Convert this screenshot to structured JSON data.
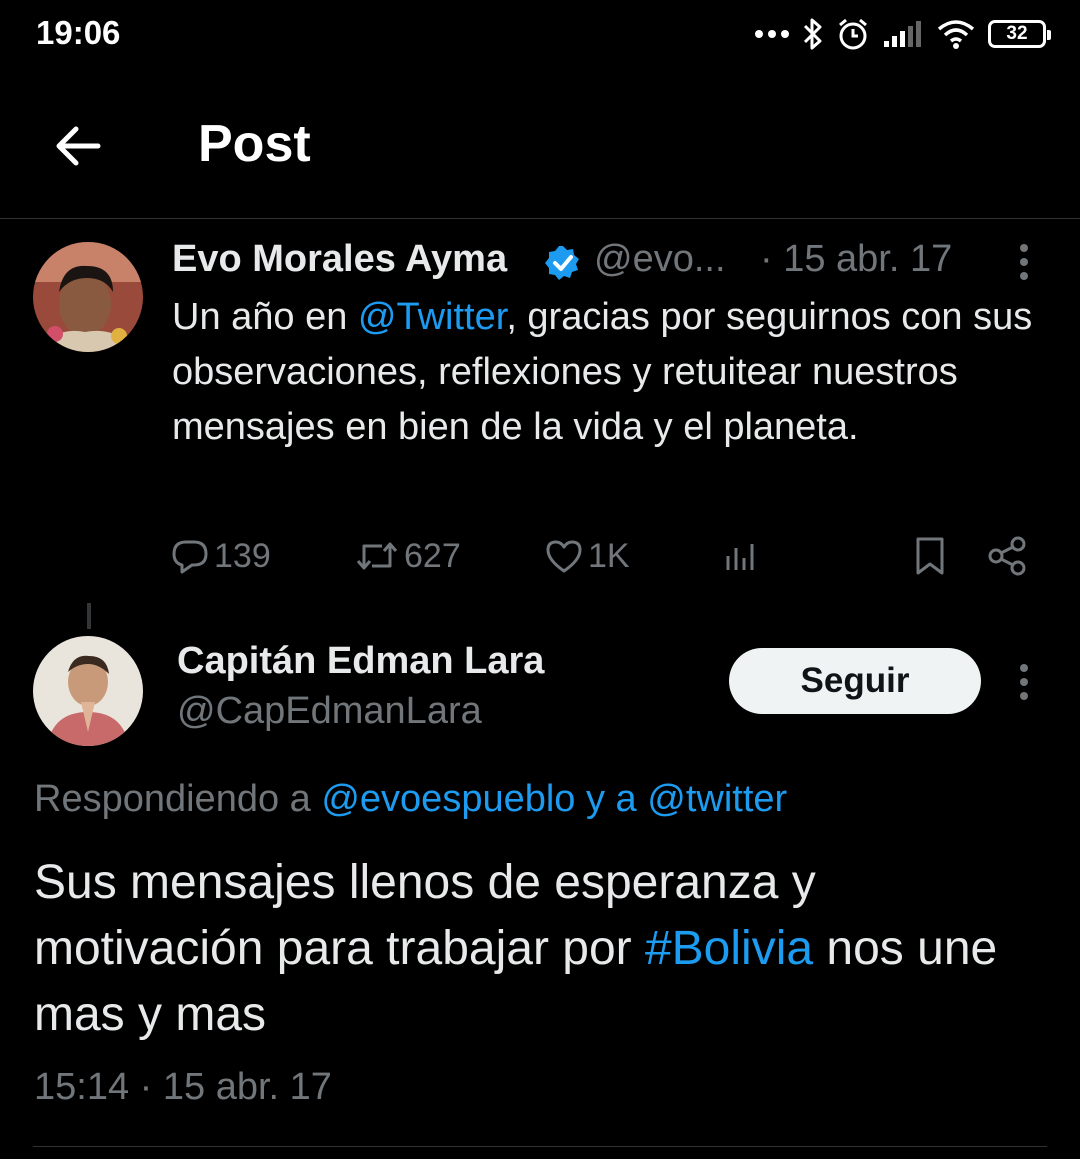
{
  "status_bar": {
    "time": "19:06",
    "battery": "32",
    "icons": [
      "more-dots-icon",
      "bluetooth-icon",
      "alarm-icon",
      "signal-icon",
      "wifi-icon",
      "battery-icon"
    ]
  },
  "header": {
    "title": "Post",
    "back_icon": "arrow-left-icon"
  },
  "tweet": {
    "author_name": "Evo Morales Ayma",
    "handle": "@evo...",
    "date": "· 15 abr. 17",
    "text_before": "Un año en ",
    "mention": "@Twitter",
    "text_after": ", gracias por seguirnos con sus observaciones, reflexiones y retuitear nuestros mensajes en bien de la vida y el planeta.",
    "replies": "139",
    "retweets": "627",
    "likes": "1K"
  },
  "reply": {
    "author_name": "Capitán Edman Lara",
    "handle": "@CapEdmanLara",
    "follow_label": "Seguir",
    "replying_prefix": "Respondiendo a ",
    "replying_to": "@evoespueblo y a @twitter",
    "text_before": "Sus mensajes llenos de esperanza y motivación para trabajar por ",
    "hashtag": "#Bolivia",
    "text_after": " nos une mas y mas",
    "timestamp": "15:14 · 15 abr. 17"
  },
  "colors": {
    "background": "#000000",
    "link": "#1d9bf0",
    "muted": "#71767b",
    "verified": "#1d9bf0"
  }
}
